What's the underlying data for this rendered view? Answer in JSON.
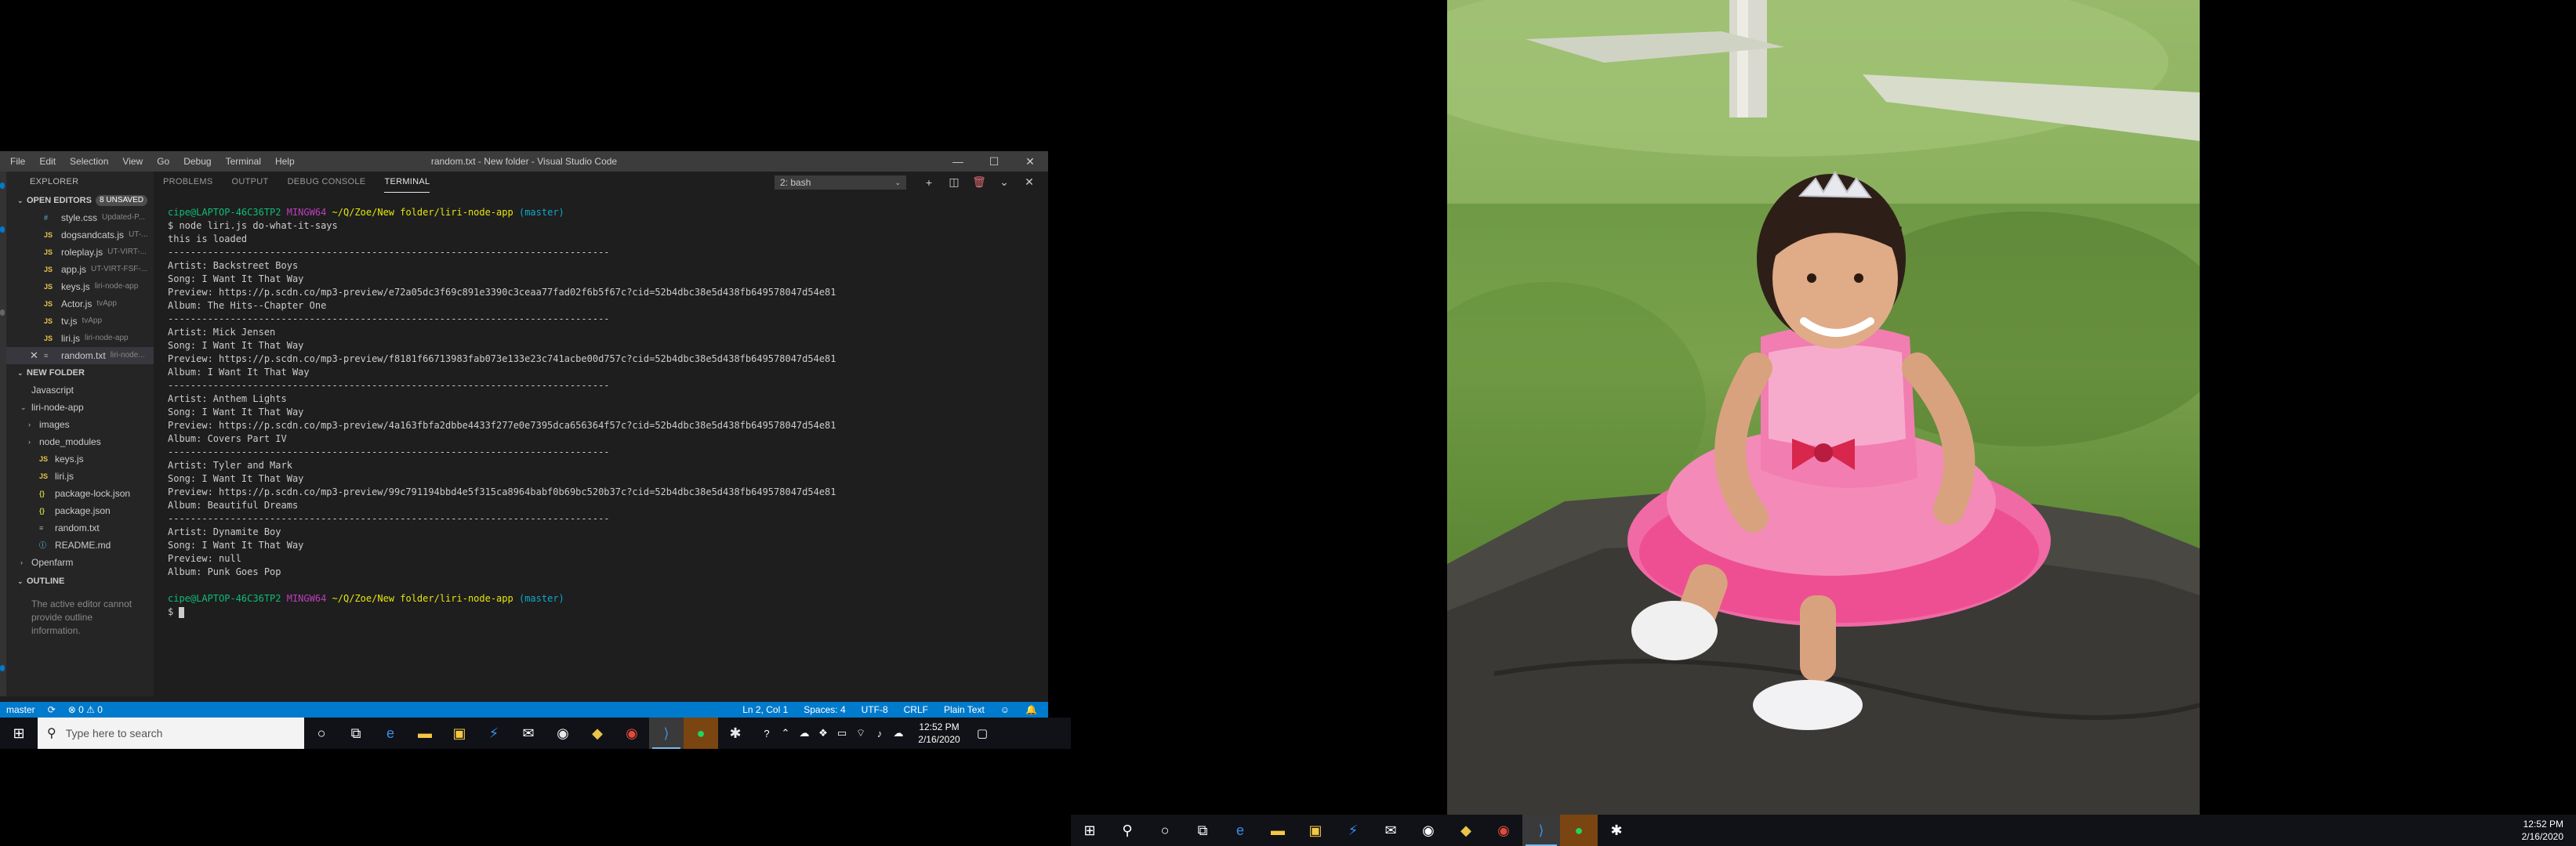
{
  "window": {
    "title": "random.txt - New folder - Visual Studio Code",
    "menu": [
      "File",
      "Edit",
      "Selection",
      "View",
      "Go",
      "Debug",
      "Terminal",
      "Help"
    ],
    "controls": [
      "—",
      "☐",
      "✕"
    ]
  },
  "sidebar": {
    "title": "EXPLORER",
    "open_editors": {
      "label": "OPEN EDITORS",
      "badge": "8 UNSAVED",
      "items": [
        {
          "icon": "#",
          "name": "style.css",
          "desc": "Updated-P..."
        },
        {
          "icon": "JS",
          "name": "dogsandcats.js",
          "desc": "UT-..."
        },
        {
          "icon": "JS",
          "name": "roleplay.js",
          "desc": "UT-VIRT-..."
        },
        {
          "icon": "JS",
          "name": "app.js",
          "desc": "UT-VIRT-FSF-..."
        },
        {
          "icon": "JS",
          "name": "keys.js",
          "desc": "liri-node-app"
        },
        {
          "icon": "JS",
          "name": "Actor.js",
          "desc": "tvApp"
        },
        {
          "icon": "JS",
          "name": "tv.js",
          "desc": "tvApp"
        },
        {
          "icon": "JS",
          "name": "liri.js",
          "desc": "liri-node-app"
        },
        {
          "icon": "≡",
          "name": "random.txt",
          "desc": "liri-node..."
        }
      ]
    },
    "folder": {
      "label": "NEW FOLDER",
      "items": [
        {
          "caret": "",
          "icon": "",
          "name": "Javascript",
          "indent": 1
        },
        {
          "caret": "⌄",
          "icon": "",
          "name": "liri-node-app",
          "indent": 1
        },
        {
          "caret": "›",
          "icon": "",
          "name": "images",
          "indent": 2
        },
        {
          "caret": "›",
          "icon": "",
          "name": "node_modules",
          "indent": 2
        },
        {
          "caret": "",
          "icon": "JS",
          "name": "keys.js",
          "indent": 2
        },
        {
          "caret": "",
          "icon": "JS",
          "name": "liri.js",
          "indent": 2
        },
        {
          "caret": "",
          "icon": "{}",
          "name": "package-lock.json",
          "indent": 2
        },
        {
          "caret": "",
          "icon": "{}",
          "name": "package.json",
          "indent": 2
        },
        {
          "caret": "",
          "icon": "≡",
          "name": "random.txt",
          "indent": 2
        },
        {
          "caret": "",
          "icon": "ⓘ",
          "name": "README.md",
          "indent": 2
        },
        {
          "caret": "›",
          "icon": "",
          "name": "Openfarm",
          "indent": 1
        }
      ]
    },
    "outline": {
      "label": "OUTLINE",
      "text": "The active editor cannot provide outline information."
    }
  },
  "panel": {
    "tabs": [
      "PROBLEMS",
      "OUTPUT",
      "DEBUG CONSOLE",
      "TERMINAL"
    ],
    "active_tab": "TERMINAL",
    "terminal_select": "2: bash",
    "actions": [
      "+",
      "◫",
      "🗑",
      "⌄",
      "✕"
    ]
  },
  "terminal": {
    "prompt_user": "cipe@LAPTOP-46C36TP2",
    "prompt_env": "MINGW64",
    "prompt_path": "~/Q/Zoe/New folder/liri-node-app",
    "prompt_branch": "(master)",
    "command": "$ node liri.js do-what-it-says",
    "loaded": "this is loaded",
    "separator": "------------------------------------------------------------------------------",
    "results": [
      {
        "artist": "Artist: Backstreet Boys",
        "song": "Song: I Want It That Way",
        "preview": "Preview: https://p.scdn.co/mp3-preview/e72a05dc3f69c891e3390c3ceaa77fad02f6b5f67c?cid=52b4dbc38e5d438fb649578047d54e81",
        "album": "Album: The Hits--Chapter One"
      },
      {
        "artist": "Artist: Mick Jensen",
        "song": "Song: I Want It That Way",
        "preview": "Preview: https://p.scdn.co/mp3-preview/f8181f66713983fab073e133e23c741acbe00d757c?cid=52b4dbc38e5d438fb649578047d54e81",
        "album": "Album: I Want It That Way"
      },
      {
        "artist": "Artist: Anthem Lights",
        "song": "Song: I Want It That Way",
        "preview": "Preview: https://p.scdn.co/mp3-preview/4a163fbfa2dbbe4433f277e0e7395dca656364f57c?cid=52b4dbc38e5d438fb649578047d54e81",
        "album": "Album: Covers Part IV"
      },
      {
        "artist": "Artist: Tyler and Mark",
        "song": "Song: I Want It That Way",
        "preview": "Preview: https://p.scdn.co/mp3-preview/99c791194bbd4e5f315ca8964babf0b69bc520b37c?cid=52b4dbc38e5d438fb649578047d54e81",
        "album": "Album: Beautiful Dreams"
      },
      {
        "artist": "Artist: Dynamite Boy",
        "song": "Song: I Want It That Way",
        "preview": "Preview: null",
        "album": "Album: Punk Goes Pop"
      }
    ],
    "final_prompt": "$ "
  },
  "statusbar": {
    "branch": "master",
    "sync": "⟳",
    "problems": "⊗ 0 ⚠ 0",
    "position": "Ln 2, Col 1",
    "spaces": "Spaces: 4",
    "encoding": "UTF-8",
    "eol": "CRLF",
    "language": "Plain Text",
    "feedback": "☺",
    "bell": "🔔"
  },
  "taskbar_left": {
    "search_placeholder": "Type here to search",
    "time": "12:52 PM",
    "date": "2/16/2020"
  },
  "taskbar_right": {
    "time": "12:52 PM",
    "date": "2/16/2020"
  },
  "colors": {
    "accent": "#007acc",
    "terminal_user": "#0dbc79",
    "terminal_env": "#bc3fbc",
    "terminal_path": "#e5e510",
    "terminal_branch": "#11a8cd"
  }
}
